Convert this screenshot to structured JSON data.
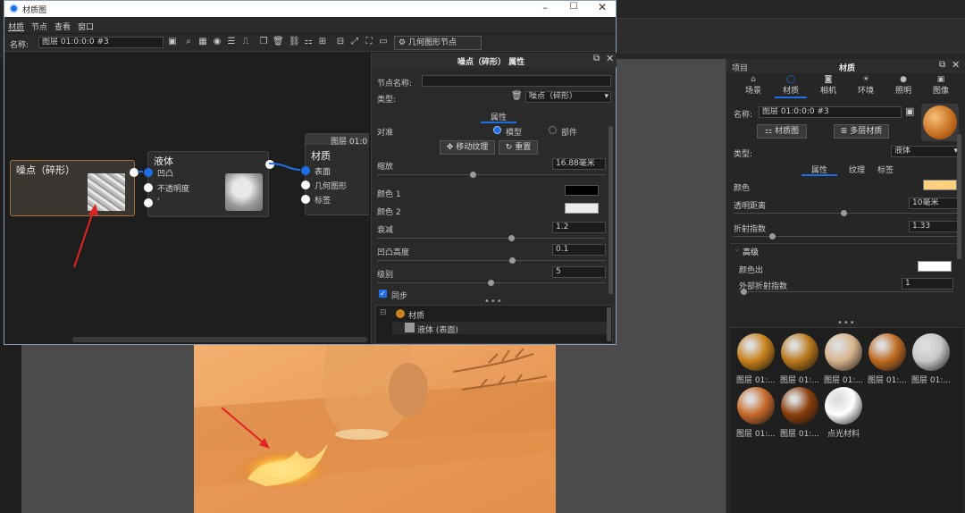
{
  "window": {
    "title": "材质图",
    "menu": [
      "材质",
      "节点",
      "查看",
      "窗口"
    ],
    "name_label": "名称:",
    "name_value": "图层 01:0:0:0 #3",
    "toolbar_geometry_node": "几何图形节点"
  },
  "graph": {
    "noise_node": {
      "title": "噪点（碎形）"
    },
    "liquid_node": {
      "title": "液体",
      "ports": [
        "凹凸",
        "不透明度",
        "'"
      ]
    },
    "material_node": {
      "header": "图层 01:0",
      "title": "材质",
      "ports": [
        "表面",
        "几何图形",
        "标签"
      ]
    }
  },
  "props": {
    "header": "噪点（碎形） 属性",
    "node_name_label": "节点名称:",
    "node_name_value": "",
    "type_label": "类型:",
    "type_value": "噪点（碎形）",
    "tab_label": "属性",
    "align_label": "对准",
    "radio_model": "模型",
    "radio_part": "部件",
    "move_texture_btn": "移动纹理",
    "reset_btn": "重置",
    "scale_label": "缩放",
    "scale_value": "16.88毫米",
    "color1_label": "颜色 1",
    "color2_label": "颜色 2",
    "decay_label": "衰减",
    "decay_value": "1.2",
    "bump_label": "凹凸高度",
    "bump_value": "0.1",
    "level_label": "级别",
    "level_value": "5",
    "sync_label": "同步",
    "tree_material": "材质",
    "tree_liquid": "液体 (表面)"
  },
  "right_panel": {
    "title_project": "项目",
    "title_material": "材质",
    "tabs": [
      "场景",
      "材质",
      "相机",
      "环境",
      "照明",
      "图像"
    ],
    "name_label": "名称:",
    "name_value": "图层 01:0:0:0 #3",
    "material_graph_btn": "材质图",
    "multilayer_btn": "多层材质",
    "type_label": "类型:",
    "type_value": "液体",
    "subtabs": [
      "属性",
      "纹理",
      "标签"
    ],
    "color_label": "颜色",
    "transparency_label": "透明距离",
    "transparency_value": "10毫米",
    "ior_label": "折射指数",
    "ior_value": "1.33",
    "advanced_label": "高级",
    "color_out_label": "颜色出",
    "outer_ior_label": "外部折射指数",
    "outer_ior_value": "1"
  },
  "library": [
    {
      "label": "图层 01:...",
      "color": "#c8811c"
    },
    {
      "label": "图层 01:...",
      "color": "#b9781c"
    },
    {
      "label": "图层 01:...",
      "color": "#d8b48c"
    },
    {
      "label": "图层 01:...",
      "color": "#c06a22"
    },
    {
      "label": "图层 01:...",
      "color": "#c8c8c8"
    },
    {
      "label": "图层 01:...",
      "color": "#c86a2a"
    },
    {
      "label": "图层 01:...",
      "color": "#8a3e0c"
    },
    {
      "label": "点光材料",
      "color": "#ffffff"
    }
  ],
  "colors": {
    "accent": "#1e6fe6",
    "viewport_orange": "#f0a060",
    "liquid_color": "#ffd080",
    "color1": "#000000",
    "color2": "#ececec"
  }
}
